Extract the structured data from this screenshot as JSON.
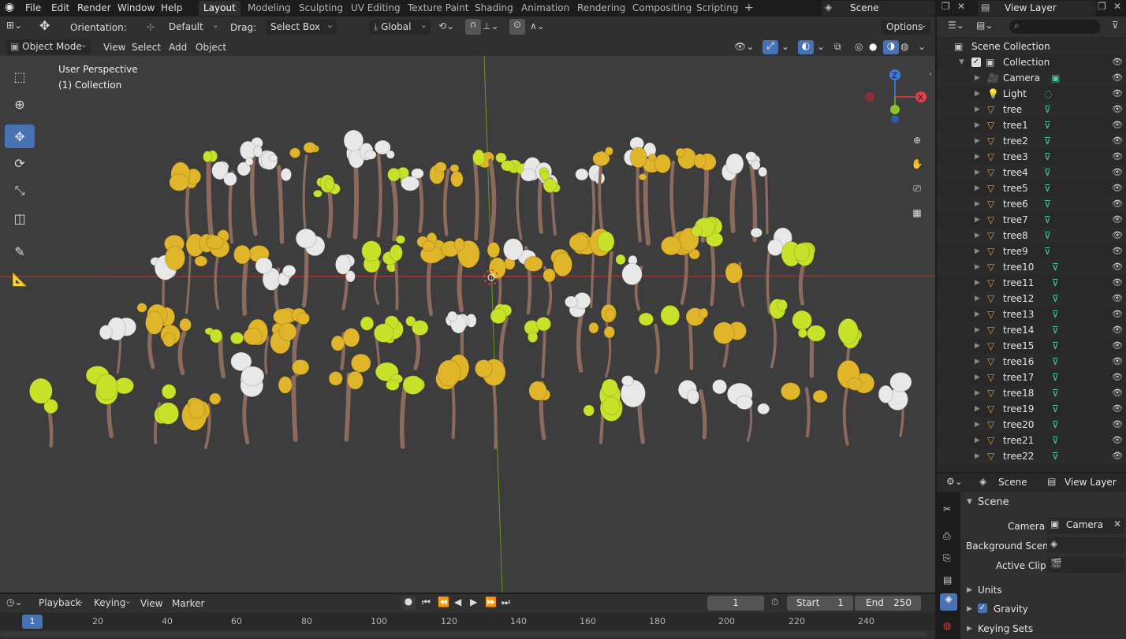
{
  "topbar": {
    "menus": [
      "File",
      "Edit",
      "Render",
      "Window",
      "Help"
    ],
    "workspaces": [
      "Layout",
      "Modeling",
      "Sculpting",
      "UV Editing",
      "Texture Paint",
      "Shading",
      "Animation",
      "Rendering",
      "Compositing",
      "Scripting"
    ],
    "active_workspace": "Layout",
    "scene_name": "Scene",
    "view_layer": "View Layer",
    "add_tab": "+"
  },
  "header": {
    "orientation_label": "Orientation:",
    "orientation_value": "Default",
    "drag_label": "Drag:",
    "drag_value": "Select Box",
    "transform_value": "Global",
    "options": "Options"
  },
  "header2": {
    "mode": "Object Mode",
    "menus": [
      "View",
      "Select",
      "Add",
      "Object"
    ]
  },
  "viewport": {
    "perspective": "User Perspective",
    "collection": "(1) Collection",
    "gizmo_x": "X",
    "gizmo_y": "Y",
    "gizmo_z": "Z"
  },
  "outliner": {
    "root": "Scene Collection",
    "collection": "Collection",
    "items": [
      "Camera",
      "Light",
      "tree",
      "tree1",
      "tree2",
      "tree3",
      "tree4",
      "tree5",
      "tree6",
      "tree7",
      "tree8",
      "tree9",
      "tree10",
      "tree11",
      "tree12",
      "tree13",
      "tree14",
      "tree15",
      "tree16",
      "tree17",
      "tree18",
      "tree19",
      "tree20",
      "tree21",
      "tree22"
    ]
  },
  "properties": {
    "tab_scene": "Scene",
    "tab_view_layer": "View Layer",
    "panel_title": "Scene",
    "camera_label": "Camera",
    "camera_value": "Camera",
    "background_label": "Background Scene",
    "active_clip_label": "Active Clip",
    "units": "Units",
    "gravity": "Gravity",
    "keying_sets": "Keying Sets"
  },
  "timeline": {
    "menus": [
      "Playback",
      "Keying",
      "View",
      "Marker"
    ],
    "current_frame": "1",
    "start_label": "Start",
    "start_value": "1",
    "end_label": "End",
    "end_value": "250",
    "ticks": [
      "1",
      "20",
      "40",
      "60",
      "80",
      "100",
      "120",
      "140",
      "160",
      "180",
      "200",
      "220",
      "240"
    ]
  },
  "colors": {
    "accent": "#4772b3",
    "axis_x": "#b53b3b",
    "axis_y": "#6a9a1f",
    "tree_trunk": "#8c6a5e",
    "leaf_yellow": "#e0b52a",
    "leaf_lime": "#c8e22a",
    "leaf_white": "#e8e8e8"
  }
}
